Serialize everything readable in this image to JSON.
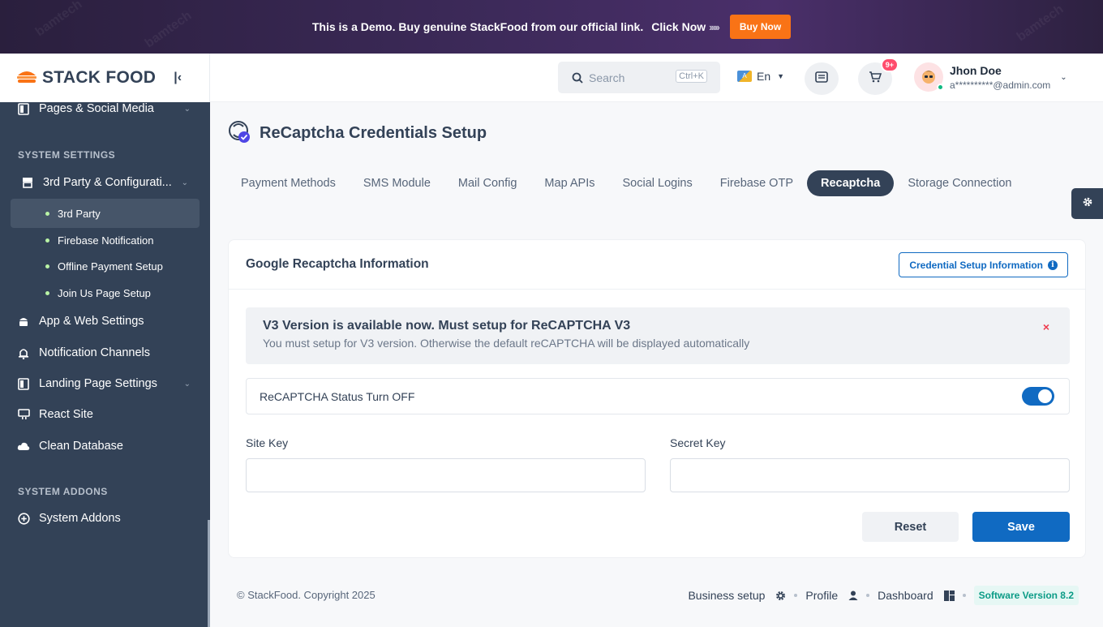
{
  "banner": {
    "message": "This is a Demo. Buy genuine StackFood from our official link.",
    "click_now": "Click Now",
    "arrows": "›››››",
    "buy_now": "Buy Now",
    "watermark": "bamtech"
  },
  "brand": {
    "logo_text": "STACK FOOD",
    "collapse_icon": "collapse-left-icon"
  },
  "sidebar": {
    "top_item": {
      "label": "Pages & Social Media",
      "icon": "pages-icon"
    },
    "system_settings_title": "SYSTEM SETTINGS",
    "third_party_group": {
      "label": "3rd Party & Configurati...",
      "icon": "store-icon"
    },
    "sub_items": [
      {
        "label": "3rd Party",
        "active": true
      },
      {
        "label": "Firebase Notification",
        "active": false
      },
      {
        "label": "Offline Payment Setup",
        "active": false
      },
      {
        "label": "Join Us Page Setup",
        "active": false
      }
    ],
    "items": [
      {
        "label": "App & Web Settings",
        "icon": "android-icon"
      },
      {
        "label": "Notification Channels",
        "icon": "bell-icon"
      },
      {
        "label": "Landing Page Settings",
        "icon": "page-icon"
      },
      {
        "label": "React Site",
        "icon": "monitor-icon"
      },
      {
        "label": "Clean Database",
        "icon": "cloud-icon"
      }
    ],
    "system_addons_title": "SYSTEM ADDONS",
    "addons_item": {
      "label": "System Addons",
      "icon": "plus-circle-icon"
    }
  },
  "header": {
    "search": {
      "placeholder": "Search",
      "shortcut": "Ctrl+K"
    },
    "language": "En",
    "cart_badge": "9+",
    "user": {
      "name": "Jhon Doe",
      "email": "a**********@admin.com"
    }
  },
  "page": {
    "title": "ReCaptcha Credentials Setup",
    "tabs": [
      {
        "label": "Payment Methods",
        "active": false
      },
      {
        "label": "SMS Module",
        "active": false
      },
      {
        "label": "Mail Config",
        "active": false
      },
      {
        "label": "Map APIs",
        "active": false
      },
      {
        "label": "Social Logins",
        "active": false
      },
      {
        "label": "Firebase OTP",
        "active": false
      },
      {
        "label": "Recaptcha",
        "active": true
      },
      {
        "label": "Storage Connection",
        "active": false
      }
    ]
  },
  "card": {
    "title": "Google Recaptcha Information",
    "info_button": "Credential Setup Information",
    "alert": {
      "title": "V3 Version is available now. Must setup for ReCAPTCHA V3",
      "text": "You must setup for V3 version. Otherwise the default reCAPTCHA will be displayed automatically",
      "close": "×"
    },
    "status": {
      "label": "ReCAPTCHA Status Turn OFF",
      "enabled": true
    },
    "site_key": {
      "label": "Site Key",
      "value": ""
    },
    "secret_key": {
      "label": "Secret Key",
      "value": ""
    },
    "reset": "Reset",
    "save": "Save"
  },
  "footer": {
    "copyright": "© StackFood. Copyright 2025",
    "links": [
      {
        "label": "Business setup",
        "icon": "gear-icon"
      },
      {
        "label": "Profile",
        "icon": "user-icon"
      },
      {
        "label": "Dashboard",
        "icon": "dashboard-icon"
      }
    ],
    "version": "Software Version 8.2"
  },
  "colors": {
    "sidebar": "#334257",
    "primary": "#106ac2",
    "buy_now": "#f97316",
    "danger": "#ee3b4d"
  }
}
